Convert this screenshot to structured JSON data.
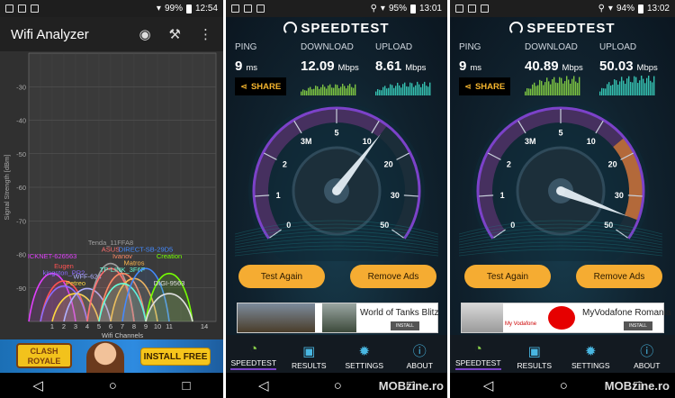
{
  "status_bars": [
    {
      "battery": "99%",
      "time": "12:54"
    },
    {
      "battery": "95%",
      "time": "13:01"
    },
    {
      "battery": "94%",
      "time": "13:02"
    }
  ],
  "wifi_analyzer": {
    "title": "Wifi Analyzer",
    "icons": [
      "eye-icon",
      "wrench-icon",
      "more-vertical-icon"
    ],
    "chart_data": {
      "type": "area",
      "title": "",
      "xlabel": "Wifi Channels",
      "ylabel": "Signal Strength [dBm]",
      "ylim": [
        -100,
        -20
      ],
      "yticks": [
        -30,
        -40,
        -50,
        -60,
        -70,
        -80,
        -90
      ],
      "xticks": [
        1,
        2,
        3,
        4,
        5,
        6,
        7,
        8,
        9,
        10,
        11,
        14
      ],
      "grid": true,
      "series": [
        {
          "name": "ICKNET-626563",
          "channel": 1,
          "dbm": -82,
          "color": "#e040fb"
        },
        {
          "name": "Eugen",
          "channel": 2,
          "dbm": -85,
          "color": "#ff5252"
        },
        {
          "name": "kingston_PR2",
          "channel": 2,
          "dbm": -87,
          "color": "#8c6cff"
        },
        {
          "name": "Petreo",
          "channel": 3,
          "dbm": -90,
          "color": "#ffd740"
        },
        {
          "name": "WFF-624",
          "channel": 4,
          "dbm": -88,
          "color": "#b0b0ff"
        },
        {
          "name": "Tenda_11FFA8",
          "channel": 6,
          "dbm": -78,
          "color": "#9e9e9e"
        },
        {
          "name": "ASUS",
          "channel": 6,
          "dbm": -80,
          "color": "#ff6e6e"
        },
        {
          "name": "Ivanov",
          "channel": 7,
          "dbm": -82,
          "color": "#ff8a65"
        },
        {
          "name": "Matros",
          "channel": 8,
          "dbm": -84,
          "color": "#ffb74d"
        },
        {
          "name": "TP-LINK_3F6F",
          "channel": 7,
          "dbm": -86,
          "color": "#64ffda"
        },
        {
          "name": "DIRECT-SB-29D5",
          "channel": 9,
          "dbm": -80,
          "color": "#448aff"
        },
        {
          "name": "Creation",
          "channel": 11,
          "dbm": -82,
          "color": "#76ff03"
        },
        {
          "name": "DIGI-9563",
          "channel": 11,
          "dbm": -90,
          "color": "#e0e0e0"
        }
      ]
    },
    "ad": {
      "line1": "CLASH",
      "line2": "ROYALE",
      "button": "INSTALL FREE"
    }
  },
  "speedtests": [
    {
      "logo": "SPEEDTEST",
      "ping_label": "PING",
      "ping": "9",
      "ping_unit": "ms",
      "download_label": "DOWNLOAD",
      "download": "12.09",
      "download_unit": "Mbps",
      "upload_label": "UPLOAD",
      "upload": "8.61",
      "upload_unit": "Mbps",
      "share": "SHARE",
      "gauge_ticks": [
        "0",
        "1",
        "2",
        "3M",
        "5",
        "10",
        "20",
        "30",
        "50"
      ],
      "test_again": "Test Again",
      "remove_ads": "Remove Ads",
      "ad_title": "World of Tanks Blitz",
      "ad_install": "INSTALL",
      "tabs": [
        "SPEEDTEST",
        "RESULTS",
        "SETTINGS",
        "ABOUT"
      ]
    },
    {
      "logo": "SPEEDTEST",
      "ping_label": "PING",
      "ping": "9",
      "ping_unit": "ms",
      "download_label": "DOWNLOAD",
      "download": "40.89",
      "download_unit": "Mbps",
      "upload_label": "UPLOAD",
      "upload": "50.03",
      "upload_unit": "Mbps",
      "share": "SHARE",
      "gauge_ticks": [
        "0",
        "1",
        "2",
        "3M",
        "5",
        "10",
        "20",
        "30",
        "50"
      ],
      "test_again": "Test Again",
      "remove_ads": "Remove Ads",
      "ad_title": "MyVodafone Romania",
      "ad_install": "INSTALL",
      "ad_small": "My Vodafone",
      "tabs": [
        "SPEEDTEST",
        "RESULTS",
        "SETTINGS",
        "ABOUT"
      ]
    }
  ],
  "watermark": "MOBzine.ro",
  "colors": {
    "accent": "#f5ac32",
    "download_graph": "#7cc442",
    "upload_graph": "#35c0b0",
    "gauge_arc": "#7c42c9"
  }
}
